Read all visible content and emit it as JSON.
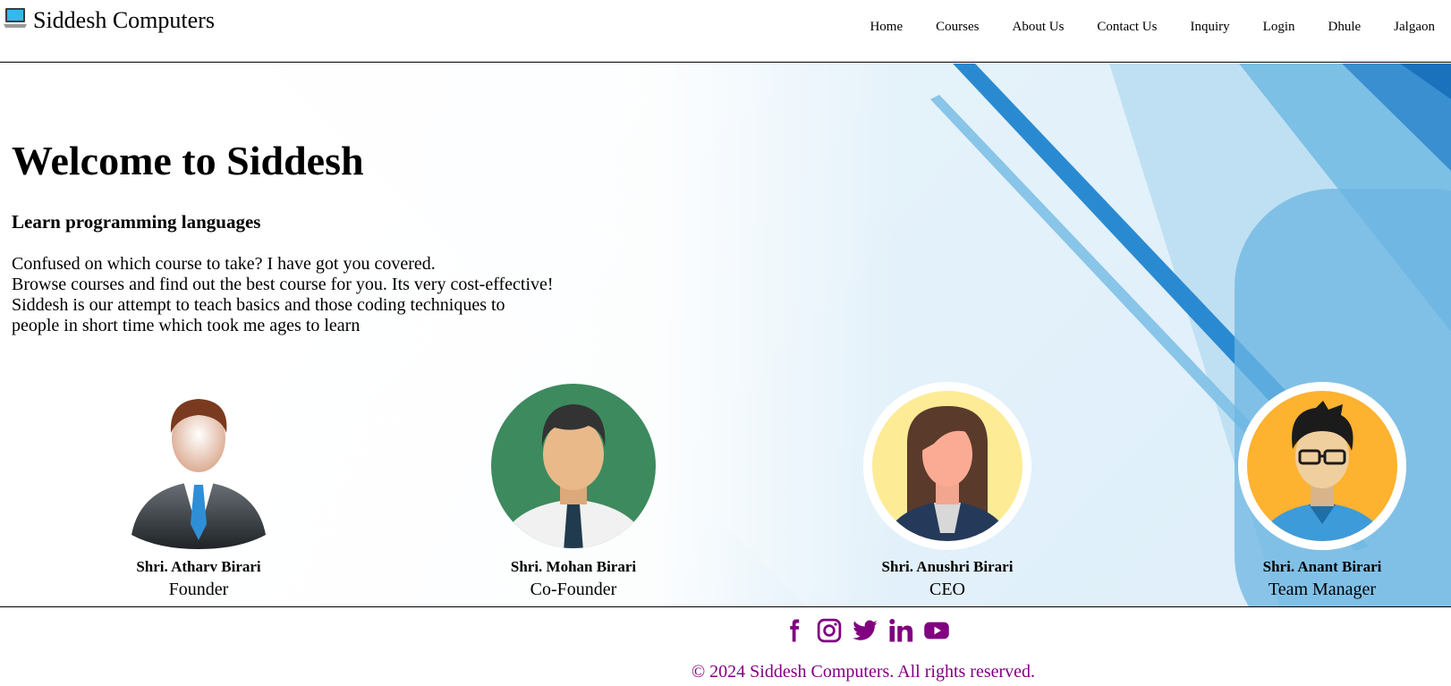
{
  "header": {
    "brand_icon": "laptop-icon",
    "brand_name": "Siddesh Computers",
    "nav": [
      "Home",
      "Courses",
      "About Us",
      "Contact Us",
      "Inquiry",
      "Login",
      "Dhule",
      "Jalgaon"
    ]
  },
  "hero": {
    "title": "Welcome to Siddesh",
    "subtitle": "Learn programming languages",
    "lines": [
      "Confused on which course to take? I have got you covered.",
      "Browse courses and find out the best course for you. Its very cost-effective!",
      "Siddesh is our attempt to teach basics and those coding techniques to",
      "people in short time which took me ages to learn"
    ]
  },
  "team": [
    {
      "name": "Shri. Atharv Birari",
      "role": "Founder",
      "avatar": "businessman-avatar"
    },
    {
      "name": "Shri. Mohan Birari",
      "role": "Co-Founder",
      "avatar": "man-tie-avatar"
    },
    {
      "name": "Shri. Anushri Birari",
      "role": "CEO",
      "avatar": "woman-avatar"
    },
    {
      "name": "Shri. Anant Birari",
      "role": "Team Manager",
      "avatar": "man-glasses-avatar"
    }
  ],
  "footer": {
    "socials": [
      "facebook-icon",
      "instagram-icon",
      "twitter-icon",
      "linkedin-icon",
      "youtube-icon"
    ],
    "copyright": "© 2024 Siddesh Computers. All rights reserved."
  },
  "colors": {
    "accent": "#800080",
    "hero_blue": "#2a8ad1",
    "hero_light": "#bfe0f3"
  }
}
